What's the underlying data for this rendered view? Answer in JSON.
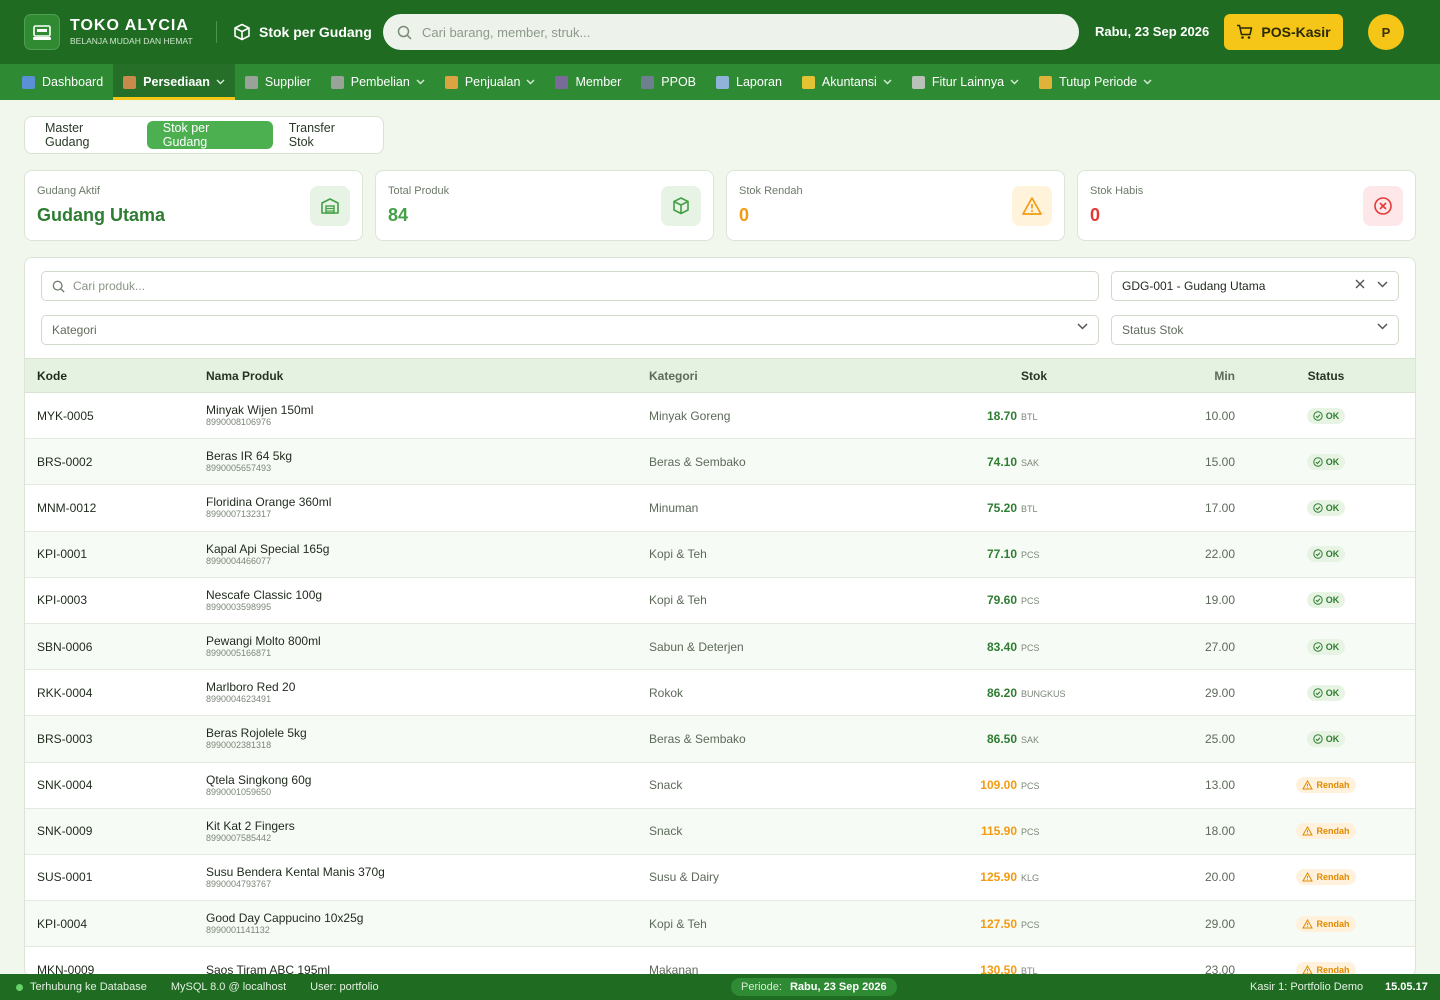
{
  "header": {
    "brand_title": "TOKO ALYCIA",
    "brand_subtitle": "BELANJA MUDAH DAN HEMAT",
    "page_context": "Stok per Gudang",
    "search_placeholder": "Cari barang, member, struk...",
    "date": "Rabu, 23 Sep 2026",
    "pos_label": "POS-Kasir",
    "avatar_initial": "P"
  },
  "nav": [
    {
      "label": "Dashboard",
      "icon": "chart-icon",
      "color": "#5b8fd6",
      "dropdown": false,
      "active": false
    },
    {
      "label": "Persediaan",
      "icon": "box-icon",
      "color": "#c98a4b",
      "dropdown": true,
      "active": true
    },
    {
      "label": "Supplier",
      "icon": "factory-icon",
      "color": "#9aa39a",
      "dropdown": false,
      "active": false
    },
    {
      "label": "Pembelian",
      "icon": "cart-icon",
      "color": "#9aa39a",
      "dropdown": true,
      "active": false
    },
    {
      "label": "Penjualan",
      "icon": "money-bag-icon",
      "color": "#d9a441",
      "dropdown": true,
      "active": false
    },
    {
      "label": "Member",
      "icon": "users-icon",
      "color": "#7a6a9a",
      "dropdown": false,
      "active": false
    },
    {
      "label": "PPOB",
      "icon": "phone-icon",
      "color": "#6f7f8f",
      "dropdown": false,
      "active": false
    },
    {
      "label": "Laporan",
      "icon": "report-icon",
      "color": "#8fb3d9",
      "dropdown": false,
      "active": false
    },
    {
      "label": "Akuntansi",
      "icon": "ledger-icon",
      "color": "#e3c233",
      "dropdown": true,
      "active": false
    },
    {
      "label": "Fitur Lainnya",
      "icon": "gear-icon",
      "color": "#b9c2b8",
      "dropdown": true,
      "active": false
    },
    {
      "label": "Tutup Periode",
      "icon": "lock-icon",
      "color": "#e0b23a",
      "dropdown": true,
      "active": false
    }
  ],
  "tabs": [
    {
      "label": "Master Gudang",
      "active": false
    },
    {
      "label": "Stok per Gudang",
      "active": true
    },
    {
      "label": "Transfer Stok",
      "active": false
    }
  ],
  "stats": [
    {
      "label": "Gudang Aktif",
      "value": "Gudang Utama",
      "color": "#2e7d32",
      "icon": "warehouse-icon",
      "icon_bg": "#e7f3e4"
    },
    {
      "label": "Total Produk",
      "value": "84",
      "color": "#43a047",
      "icon": "cube-icon",
      "icon_bg": "#e7f3e4"
    },
    {
      "label": "Stok Rendah",
      "value": "0",
      "color": "#f29b12",
      "icon": "warning-icon",
      "icon_bg": "#fff3dc"
    },
    {
      "label": "Stok Habis",
      "value": "0",
      "color": "#e53935",
      "icon": "x-circle-icon",
      "icon_bg": "#fde7e8"
    }
  ],
  "filters": {
    "search_placeholder": "Cari produk...",
    "gudang_value": "GDG-001 - Gudang Utama",
    "kategori_placeholder": "Kategori",
    "status_placeholder": "Status Stok"
  },
  "table": {
    "headers": {
      "kode": "Kode",
      "nama": "Nama Produk",
      "kategori": "Kategori",
      "stok": "Stok",
      "min": "Min",
      "status": "Status"
    },
    "rows": [
      {
        "kode": "MYK-0005",
        "nama": "Minyak Wijen 150ml",
        "barcode": "8990008106976",
        "kategori": "Minyak Goreng",
        "stok": "18.70",
        "unit": "BTL",
        "min": "10.00",
        "status": "OK"
      },
      {
        "kode": "BRS-0002",
        "nama": "Beras IR 64 5kg",
        "barcode": "8990005657493",
        "kategori": "Beras & Sembako",
        "stok": "74.10",
        "unit": "SAK",
        "min": "15.00",
        "status": "OK"
      },
      {
        "kode": "MNM-0012",
        "nama": "Floridina Orange 360ml",
        "barcode": "8990007132317",
        "kategori": "Minuman",
        "stok": "75.20",
        "unit": "BTL",
        "min": "17.00",
        "status": "OK"
      },
      {
        "kode": "KPI-0001",
        "nama": "Kapal Api Special 165g",
        "barcode": "8990004466077",
        "kategori": "Kopi & Teh",
        "stok": "77.10",
        "unit": "PCS",
        "min": "22.00",
        "status": "OK"
      },
      {
        "kode": "KPI-0003",
        "nama": "Nescafe Classic 100g",
        "barcode": "8990003598995",
        "kategori": "Kopi & Teh",
        "stok": "79.60",
        "unit": "PCS",
        "min": "19.00",
        "status": "OK"
      },
      {
        "kode": "SBN-0006",
        "nama": "Pewangi Molto 800ml",
        "barcode": "8990005166871",
        "kategori": "Sabun & Deterjen",
        "stok": "83.40",
        "unit": "PCS",
        "min": "27.00",
        "status": "OK"
      },
      {
        "kode": "RKK-0004",
        "nama": "Marlboro Red 20",
        "barcode": "8990004623491",
        "kategori": "Rokok",
        "stok": "86.20",
        "unit": "BUNGKUS",
        "min": "29.00",
        "status": "OK"
      },
      {
        "kode": "BRS-0003",
        "nama": "Beras Rojolele 5kg",
        "barcode": "8990002381318",
        "kategori": "Beras & Sembako",
        "stok": "86.50",
        "unit": "SAK",
        "min": "25.00",
        "status": "OK"
      },
      {
        "kode": "SNK-0004",
        "nama": "Qtela Singkong 60g",
        "barcode": "8990001059650",
        "kategori": "Snack",
        "stok": "109.00",
        "unit": "PCS",
        "min": "13.00",
        "status": "Rendah"
      },
      {
        "kode": "SNK-0009",
        "nama": "Kit Kat 2 Fingers",
        "barcode": "8990007585442",
        "kategori": "Snack",
        "stok": "115.90",
        "unit": "PCS",
        "min": "18.00",
        "status": "Rendah"
      },
      {
        "kode": "SUS-0001",
        "nama": "Susu Bendera Kental Manis 370g",
        "barcode": "8990004793767",
        "kategori": "Susu & Dairy",
        "stok": "125.90",
        "unit": "KLG",
        "min": "20.00",
        "status": "Rendah"
      },
      {
        "kode": "KPI-0004",
        "nama": "Good Day Cappucino 10x25g",
        "barcode": "8990001141132",
        "kategori": "Kopi & Teh",
        "stok": "127.50",
        "unit": "PCS",
        "min": "29.00",
        "status": "Rendah"
      },
      {
        "kode": "MKN-0009",
        "nama": "Saos Tiram ABC 195ml",
        "barcode": "",
        "kategori": "Makanan",
        "stok": "130.50",
        "unit": "BTL",
        "min": "23.00",
        "status": "Rendah"
      }
    ]
  },
  "statusbar": {
    "connection": "Terhubung ke Database",
    "db": "MySQL 8.0 @ localhost",
    "user": "User: portfolio",
    "periode_label": "Periode:",
    "periode_value": "Rabu, 23 Sep 2026",
    "kasir": "Kasir 1: Portfolio Demo",
    "time": "15.05.17"
  },
  "colors": {
    "ok": "#2e7d32",
    "low": "#f29b12",
    "primary": "#1f6b22"
  }
}
